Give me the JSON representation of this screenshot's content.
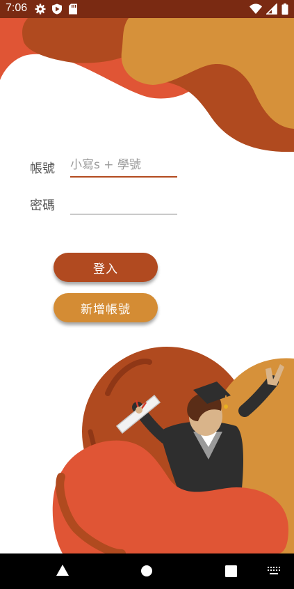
{
  "status_bar": {
    "time": "7:06"
  },
  "form": {
    "account_label": "帳號",
    "account_placeholder": "小寫s + 學號",
    "account_value": "",
    "password_label": "密碼",
    "password_value": ""
  },
  "buttons": {
    "login": "登入",
    "register": "新增帳號"
  },
  "colors": {
    "status_bar": "#7a2a12",
    "primary": "#b14a20",
    "secondary": "#d48c34",
    "accent_red": "#e05535",
    "nav_bar": "#000000"
  },
  "icons": {
    "status_left": [
      "gear-icon",
      "play-protect-icon",
      "sd-card-icon"
    ],
    "status_right": [
      "wifi-icon",
      "signal-icon",
      "battery-icon"
    ],
    "nav": [
      "back-icon",
      "home-icon",
      "recents-icon",
      "keyboard-icon"
    ]
  }
}
